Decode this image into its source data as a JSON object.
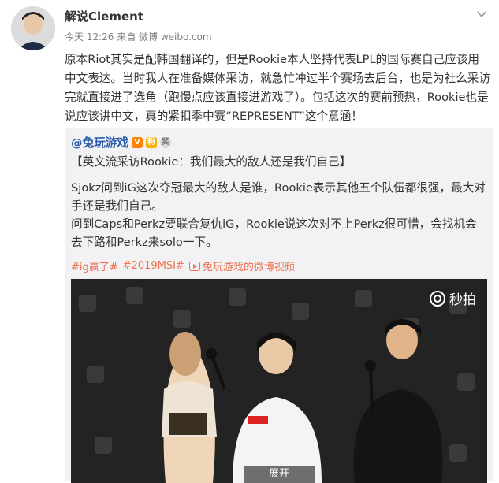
{
  "post": {
    "username": "解说Clement",
    "meta": "今天 12:26 来自 微博 weibo.com",
    "text": "原本Riot其实是配韩国翻译的，但是Rookie本人坚持代表LPL的国际赛自己应该用中文表达。当时我人在准备媒体采访，就急忙冲过半个赛场去后台，也是为社么采访完就直接进了选角（跑慢点应该直接进游戏了）。包括这次的赛前预热，Rookie也是说应该讲中文，真的紧扣季中赛“REPRESENT”这个意涵！"
  },
  "repost": {
    "author": "@兔玩游戏",
    "badges": [
      "V",
      "粉",
      "奖"
    ],
    "title_line": "【英文流采访Rookie：我们最大的敌人还是我们自己】",
    "para1": "Sjokz问到iG这次夺冠最大的敌人是谁，Rookie表示其他五个队伍都很强，最大对手还是我们自己。",
    "para2": "问到Caps和Perkz要联合复仇iG，Rookie说这次对不上Perkz很可惜，会找机会去下路和Perkz来solo一下。",
    "tags": [
      "#ig赢了#",
      "#2019MSI#"
    ],
    "video_link": "兔玩游戏的微博视频"
  },
  "video": {
    "brand": "秒拍",
    "expand_label": "展开"
  },
  "colors": {
    "link": "#2a5caa",
    "tag": "#eb7350",
    "repost_bg": "#f2f2f5"
  },
  "icons": [
    "avatar",
    "chevron-down-icon",
    "verified-badge-icon",
    "fan-badge-icon",
    "medal-icon",
    "video-link-icon",
    "miaopai-logo-icon"
  ]
}
